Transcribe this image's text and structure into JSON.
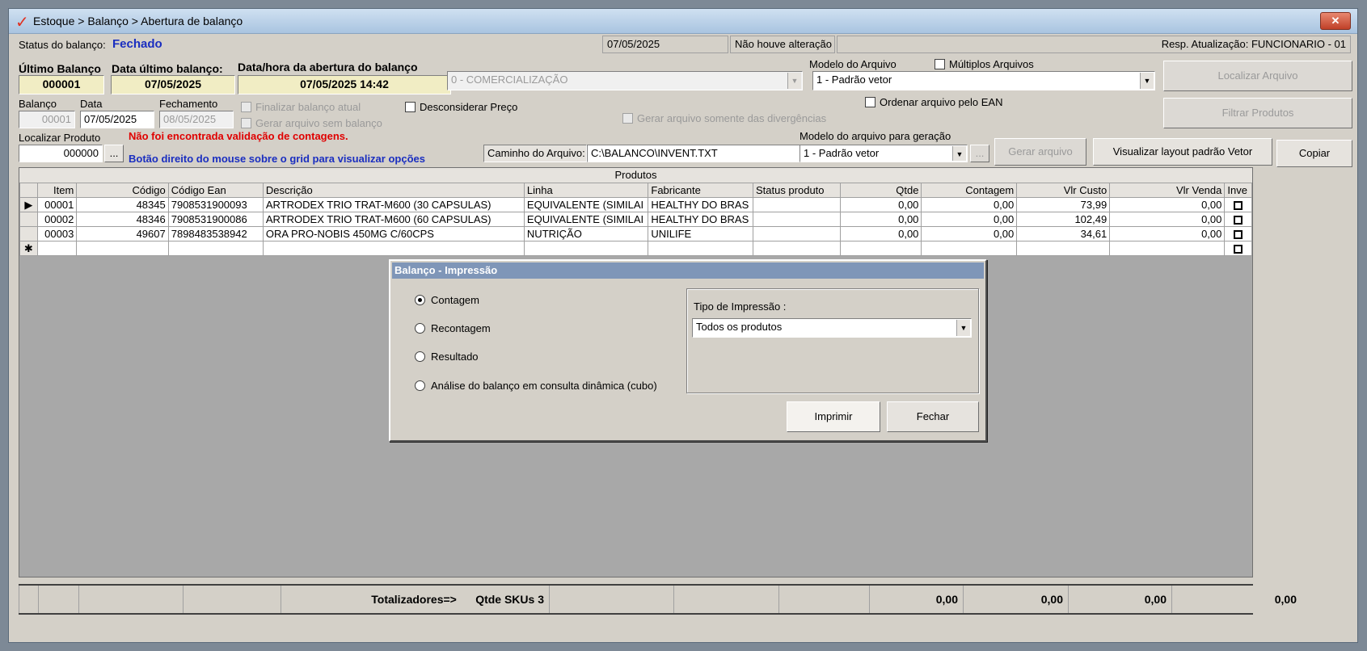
{
  "window": {
    "title": "Estoque > Balanço > Abertura de balanço",
    "close_label": "✕"
  },
  "status": {
    "label": "Status do balanço:",
    "value": "Fechado",
    "date": "07/05/2025",
    "change_text": "Não houve alteração",
    "resp": "Resp. Atualização: FUNCIONARIO - 01"
  },
  "header": {
    "ultimo_balanco_label": "Último Balanço",
    "ultimo_balanco_value": "000001",
    "data_ultimo_label": "Data último balanço:",
    "data_ultimo_value": "07/05/2025",
    "abertura_label": "Data/hora da abertura do balanço",
    "abertura_value": "07/05/2025 14:42",
    "comercializacao_value": "0 - COMERCIALIZAÇÃO",
    "modelo_arquivo_label": "Modelo do Arquivo",
    "modelo_arquivo_value": "1 - Padrão vetor",
    "multiplos_label": "Múltiplos Arquivos",
    "localizar_arquivo_label": "Localizar Arquivo"
  },
  "balanco": {
    "balanco_label": "Balanço",
    "balanco_value": "00001",
    "data_label": "Data",
    "data_value": "07/05/2025",
    "fechamento_label": "Fechamento",
    "fechamento_value": "08/05/2025",
    "finalizar_label": "Finalizar balanço atual",
    "gerar_sem_label": "Gerar arquivo sem balanço",
    "desconsiderar_label": "Desconsiderar Preço",
    "gerar_divergencias_label": "Gerar arquivo somente das divergências",
    "ordenar_ean_label": "Ordenar arquivo pelo EAN",
    "filtrar_label": "Filtrar Produtos"
  },
  "produto": {
    "localizar_label": "Localizar Produto",
    "localizar_value": "000000",
    "dots_label": "...",
    "warning": "Não foi encontrada validação de contagens.",
    "hint": "Botão direito do mouse sobre o grid para visualizar opções",
    "caminho_label": "Caminho do Arquivo:",
    "caminho_value": "C:\\BALANCO\\INVENT.TXT",
    "modelo_geracao_label": "Modelo do arquivo para geração",
    "modelo_geracao_value": "1 - Padrão vetor",
    "gerar_arquivo_label": "Gerar arquivo",
    "visualizar_label": "Visualizar layout padrão Vetor",
    "copiar_label": "Copiar"
  },
  "grid": {
    "caption": "Produtos",
    "columns": [
      "Item",
      "Código",
      "Código Ean",
      "Descrição",
      "Linha",
      "Fabricante",
      "Status produto",
      "Qtde",
      "Contagem",
      "Vlr Custo",
      "Vlr Venda",
      "Inve"
    ],
    "rows": [
      {
        "item": "00001",
        "codigo": "48345",
        "ean": "7908531900093",
        "descricao": "ARTRODEX TRIO TRAT-M600 (30 CAPSULAS)",
        "linha": "EQUIVALENTE (SIMILAI",
        "fabricante": "HEALTHY DO BRAS",
        "status": "",
        "qtde": "0,00",
        "contagem": "0,00",
        "custo": "73,99",
        "venda": "0,00"
      },
      {
        "item": "00002",
        "codigo": "48346",
        "ean": "7908531900086",
        "descricao": "ARTRODEX TRIO TRAT-M600 (60 CAPSULAS)",
        "linha": "EQUIVALENTE (SIMILAI",
        "fabricante": "HEALTHY DO BRAS",
        "status": "",
        "qtde": "0,00",
        "contagem": "0,00",
        "custo": "102,49",
        "venda": "0,00"
      },
      {
        "item": "00003",
        "codigo": "49607",
        "ean": "7898483538942",
        "descricao": "ORA PRO-NOBIS 450MG C/60CPS",
        "linha": "NUTRIÇÃO",
        "fabricante": "UNILIFE",
        "status": "",
        "qtde": "0,00",
        "contagem": "0,00",
        "custo": "34,61",
        "venda": "0,00"
      }
    ],
    "current_row_marker": "▶",
    "new_row_marker": "✱"
  },
  "totals": {
    "label": "Totalizadores=>",
    "skus": "Qtde SKUs 3",
    "qtde": "0,00",
    "contagem": "0,00",
    "custo": "0,00",
    "venda": "0,00"
  },
  "dialog": {
    "title": "Balanço - Impressão",
    "options": [
      "Contagem",
      "Recontagem",
      "Resultado",
      "Análise do balanço em consulta dinâmica (cubo)"
    ],
    "selected_option": "Contagem",
    "tipo_label": "Tipo de Impressão :",
    "tipo_value": "Todos os produtos",
    "imprimir_label": "Imprimir",
    "fechar_label": "Fechar"
  }
}
